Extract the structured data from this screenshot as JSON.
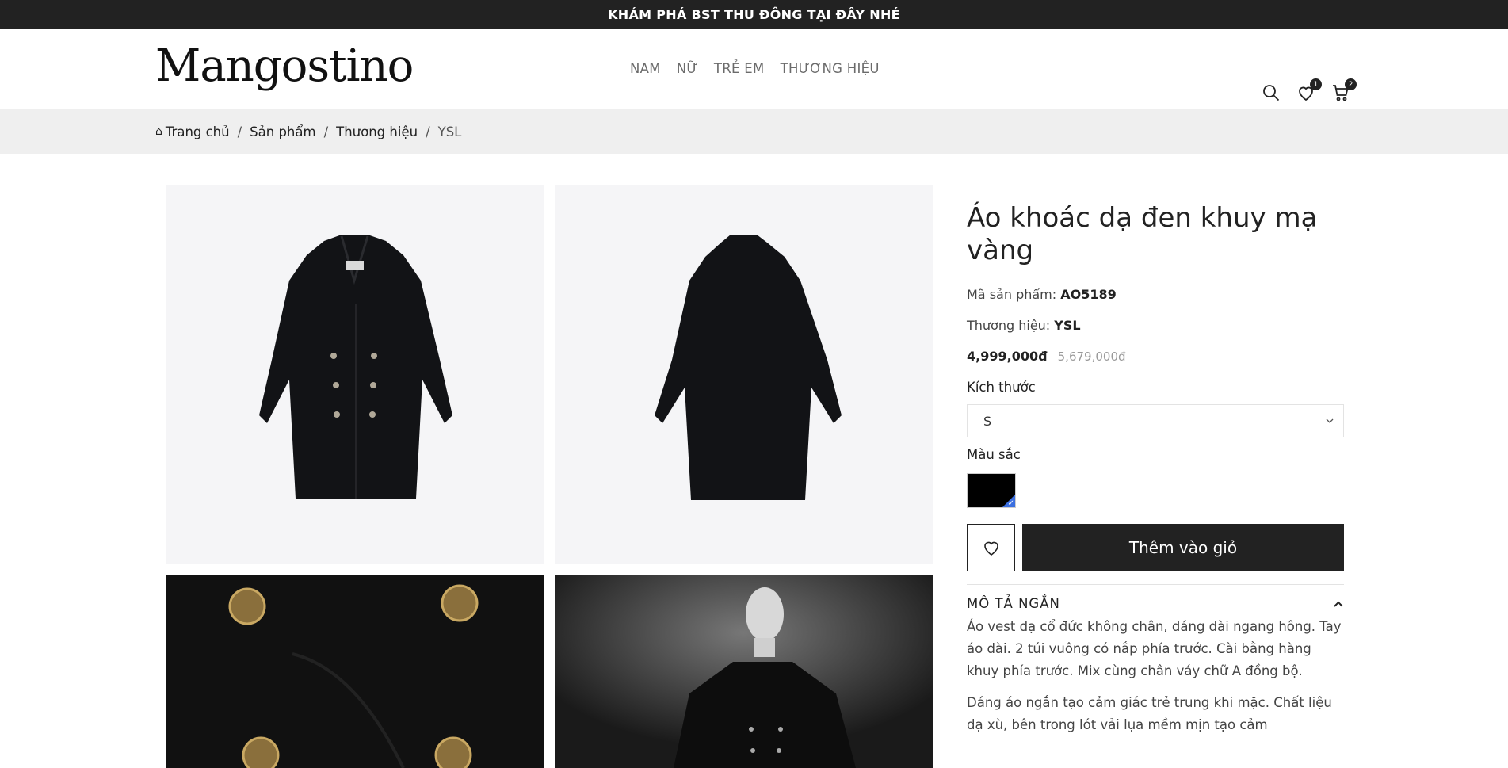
{
  "topbar": {
    "text": "KHÁM PHÁ BST THU ĐÔNG TẠI ĐÂY NHÉ"
  },
  "header": {
    "logo": "Mangostino",
    "nav": [
      "NAM",
      "NỮ",
      "TRẺ EM",
      "THƯƠNG HIỆU"
    ],
    "wishlist_count": "1",
    "cart_count": "2"
  },
  "breadcrumb": {
    "home": "Trang chủ",
    "products": "Sản phẩm",
    "brands": "Thương hiệu",
    "current": "YSL",
    "sep": "/"
  },
  "product": {
    "title": "Áo khoác dạ đen khuy mạ vàng",
    "sku_label": "Mã sản phẩm:",
    "sku": "AO5189",
    "brand_label": "Thương hiệu:",
    "brand": "YSL",
    "price": "4,999,000đ",
    "old_price": "5,679,000đ",
    "size_label": "Kích thước",
    "size_value": "S",
    "color_label": "Màu sắc",
    "color_value": "#000000",
    "add_to_cart": "Thêm vào giỏ",
    "desc_heading": "MÔ TẢ NGẮN",
    "desc_p1": "Áo vest dạ cổ đức không chân, dáng dài ngang hông. Tay áo dài. 2 túi vuông có nắp phía trước. Cài bằng hàng khuy phía trước. Mix cùng chân váy chữ A đồng bộ.",
    "desc_p2": "Dáng áo ngắn tạo cảm giác trẻ trung khi mặc. Chất liệu dạ xù, bên trong lót vải lụa mềm mịn tạo cảm"
  },
  "colors": {
    "accent": "#222222",
    "check": "#3b6fe0",
    "image_bg": "#f5f5f7"
  }
}
